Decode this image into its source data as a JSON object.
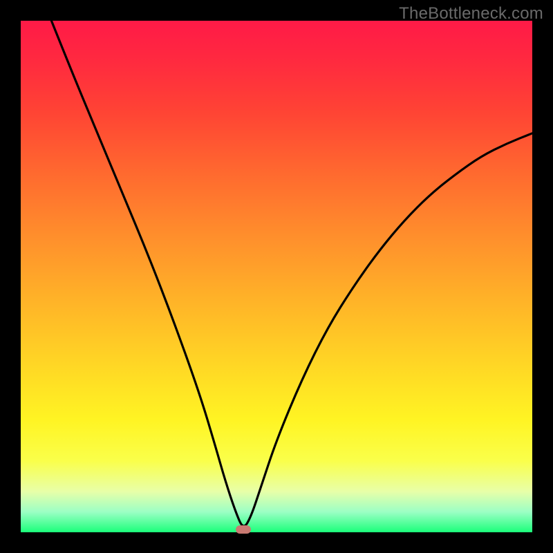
{
  "watermark": "TheBottleneck.com",
  "chart_data": {
    "type": "line",
    "title": "",
    "xlabel": "",
    "ylabel": "",
    "xlim": [
      0,
      100
    ],
    "ylim": [
      0,
      100
    ],
    "grid": false,
    "series": [
      {
        "name": "curve",
        "x": [
          6,
          10,
          15,
          20,
          25,
          30,
          35,
          38,
          40,
          42,
          43.5,
          45,
          47,
          50,
          55,
          60,
          65,
          70,
          75,
          80,
          85,
          90,
          95,
          100
        ],
        "y": [
          100,
          90,
          78,
          66,
          54,
          41,
          27,
          17,
          10,
          4,
          0.5,
          3,
          9,
          18,
          30,
          40,
          48,
          55,
          61,
          66,
          70,
          73.5,
          76,
          78
        ]
      }
    ],
    "marker": {
      "x": 43.5,
      "y": 0.5,
      "color": "#c97a72"
    },
    "background_gradient": {
      "direction": "top_to_bottom",
      "stops": [
        {
          "pos": 0,
          "color": "#ff1a47"
        },
        {
          "pos": 50,
          "color": "#ff9a2b"
        },
        {
          "pos": 80,
          "color": "#fff423"
        },
        {
          "pos": 100,
          "color": "#1bff7a"
        }
      ]
    }
  }
}
